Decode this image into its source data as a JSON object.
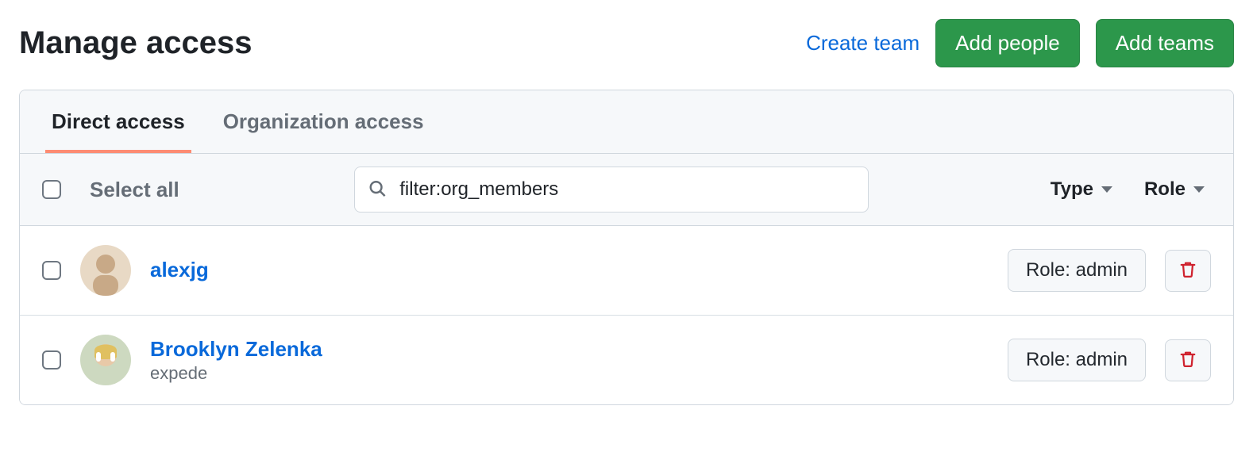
{
  "header": {
    "title": "Manage access",
    "create_team_link": "Create team",
    "add_people_btn": "Add people",
    "add_teams_btn": "Add teams"
  },
  "tabs": {
    "direct": "Direct access",
    "org": "Organization access"
  },
  "toolbar": {
    "select_all": "Select all",
    "search_value": "filter:org_members",
    "type_label": "Type",
    "role_label": "Role"
  },
  "rows": [
    {
      "display_name": "alexjg",
      "username": "",
      "role_button": "Role: admin"
    },
    {
      "display_name": "Brooklyn Zelenka",
      "username": "expede",
      "role_button": "Role: admin"
    }
  ]
}
